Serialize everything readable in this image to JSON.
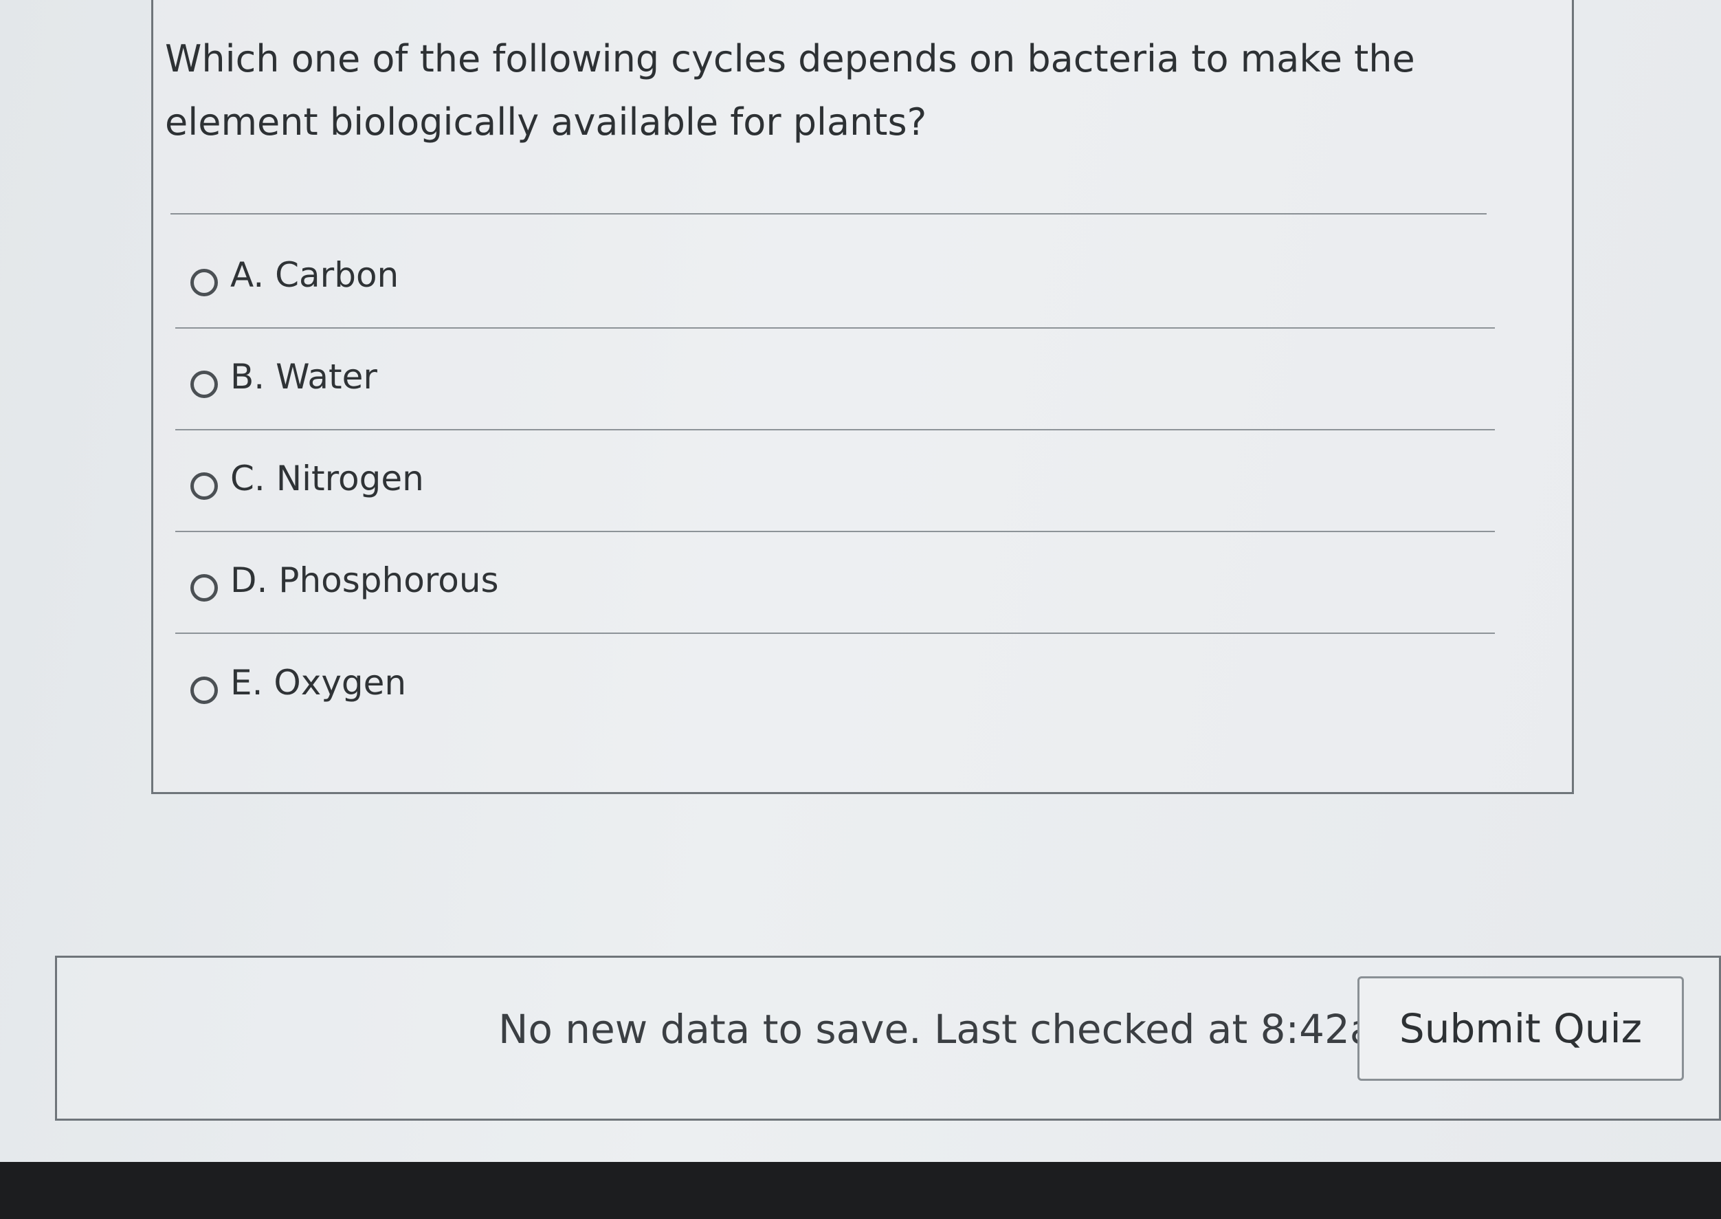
{
  "question": {
    "text": "Which one of the following cycles depends on bacteria to make the element biologically available for plants?",
    "answers": [
      {
        "label": "A. Carbon"
      },
      {
        "label": "B. Water"
      },
      {
        "label": "C. Nitrogen"
      },
      {
        "label": "D. Phosphorous"
      },
      {
        "label": "E. Oxygen"
      }
    ]
  },
  "footer": {
    "status_text": "No new data to save. Last checked at 8:42am",
    "submit_label": "Submit Quiz"
  },
  "colors": {
    "background": "#e8ebee",
    "border": "#6f757a",
    "text": "#2d3134"
  }
}
